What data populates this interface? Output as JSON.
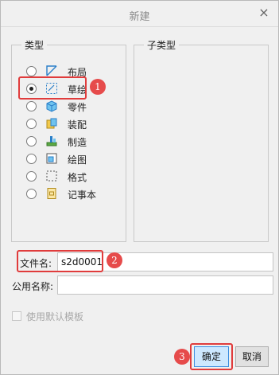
{
  "dialog": {
    "title": "新建",
    "close_symbol": "×"
  },
  "type_group": {
    "title": "类型",
    "items": [
      {
        "label": "布局",
        "icon": "layout-icon",
        "selected": false
      },
      {
        "label": "草绘",
        "icon": "sketch-icon",
        "selected": true
      },
      {
        "label": "零件",
        "icon": "part-icon",
        "selected": false
      },
      {
        "label": "装配",
        "icon": "assembly-icon",
        "selected": false
      },
      {
        "label": "制造",
        "icon": "manufacturing-icon",
        "selected": false
      },
      {
        "label": "绘图",
        "icon": "drawing-icon",
        "selected": false
      },
      {
        "label": "格式",
        "icon": "format-icon",
        "selected": false
      },
      {
        "label": "记事本",
        "icon": "notebook-icon",
        "selected": false
      }
    ]
  },
  "subtype_group": {
    "title": "子类型"
  },
  "filename": {
    "label": "文件名:",
    "value": "s2d0001"
  },
  "common_name": {
    "label": "公用名称:",
    "value": ""
  },
  "default_template": {
    "label": "使用默认模板",
    "checked": false
  },
  "buttons": {
    "ok": "确定",
    "cancel": "取消"
  },
  "annotations": {
    "badge1": "1",
    "badge2": "2",
    "badge3": "3",
    "color": "#e64b4b"
  }
}
